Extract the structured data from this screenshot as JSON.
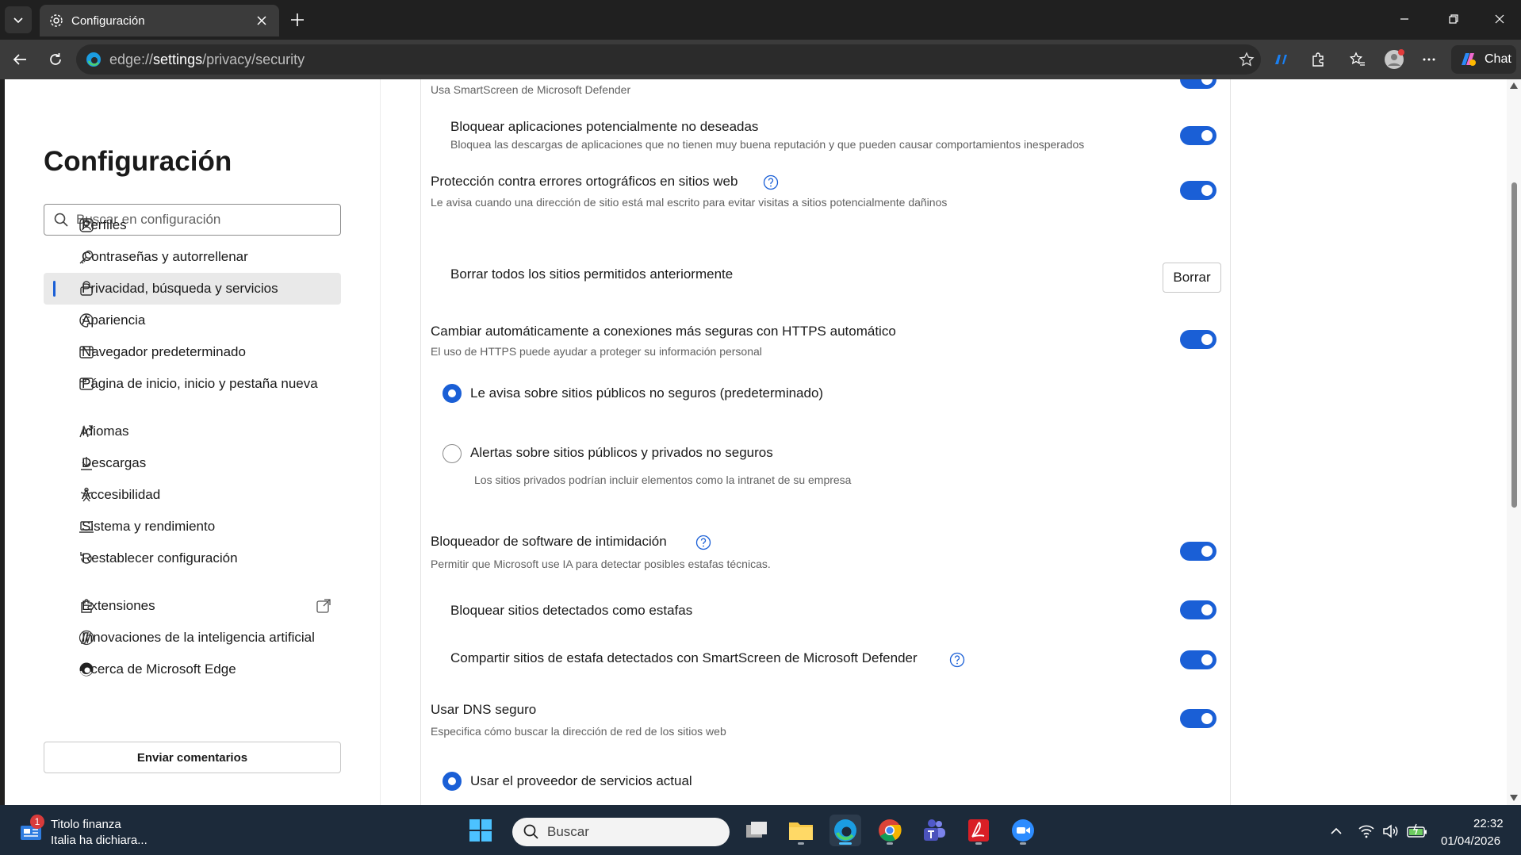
{
  "browser": {
    "tab_title": "Configuración",
    "url_prefix": "edge://",
    "url_host": "settings",
    "url_path": "/privacy/security",
    "chat_label": "Chat"
  },
  "sidebar": {
    "title": "Configuración",
    "search_placeholder": "Buscar en configuración",
    "items": [
      {
        "label": "Perfiles",
        "icon": "profile-icon"
      },
      {
        "label": "Contraseñas y autorrellenar",
        "icon": "key-icon"
      },
      {
        "label": "Privacidad, búsqueda y servicios",
        "icon": "lock-icon",
        "active": true
      },
      {
        "label": "Apariencia",
        "icon": "palette-icon"
      },
      {
        "label": "Navegador predeterminado",
        "icon": "browser-icon"
      },
      {
        "label": "Página de inicio, inicio y pestaña nueva",
        "icon": "home-tab-icon"
      },
      {
        "label": "Idiomas",
        "icon": "language-icon"
      },
      {
        "label": "Descargas",
        "icon": "download-icon"
      },
      {
        "label": "Accesibilidad",
        "icon": "accessibility-icon"
      },
      {
        "label": "Sistema y rendimiento",
        "icon": "laptop-icon"
      },
      {
        "label": "Restablecer configuración",
        "icon": "reset-icon"
      },
      {
        "label": "Extensiones",
        "icon": "puzzle-icon"
      },
      {
        "label": "Innovaciones de la inteligencia artificial",
        "icon": "ai-icon"
      },
      {
        "label": "Acerca de Microsoft Edge",
        "icon": "edge-icon"
      }
    ],
    "feedback_label": "Enviar comentarios"
  },
  "content": {
    "smartscreen_desc": "Usa SmartScreen de Microsoft Defender",
    "pua_title": "Bloquear aplicaciones potencialmente no deseadas",
    "pua_desc": "Bloquea las descargas de aplicaciones que no tienen muy buena reputación y que pueden causar comportamientos inesperados",
    "typo_title": "Protección contra errores ortográficos en sitios web",
    "typo_desc": "Le avisa cuando una dirección de sitio está mal escrito para evitar visitas a sitios potencialmente dañinos",
    "clear_title": "Borrar todos los sitios permitidos anteriormente",
    "clear_button": "Borrar",
    "https_title": "Cambiar automáticamente a conexiones más seguras con HTTPS automático",
    "https_desc": "El uso de HTTPS puede ayudar a proteger su información personal",
    "https_opt1": "Le avisa sobre sitios públicos no seguros (predeterminado)",
    "https_opt2": "Alertas sobre sitios públicos y privados no seguros",
    "https_opt2_desc": "Los sitios privados podrían incluir elementos como la intranet de su empresa",
    "scare_title": "Bloqueador de software de intimidación",
    "scare_desc": "Permitir que Microsoft use IA para detectar posibles estafas técnicas.",
    "scam_block_title": "Bloquear sitios detectados como estafas",
    "scam_share_title": "Compartir sitios de estafa detectados con SmartScreen de Microsoft Defender",
    "dns_title": "Usar DNS seguro",
    "dns_desc": "Especifica cómo buscar la dirección de red de los sitios web",
    "dns_opt1": "Usar el proveedor de servicios actual"
  },
  "taskbar": {
    "news_badge": "1",
    "news_title": "Titolo finanza",
    "news_sub": "Italia ha dichiara...",
    "search_placeholder": "Buscar",
    "time": "22:32",
    "date": "01/04/2026"
  },
  "colors": {
    "accent": "#1a5fd6",
    "chrome_dark": "#202020",
    "toolbar": "#3b3b3b",
    "taskbar": "#1c2a3a"
  }
}
